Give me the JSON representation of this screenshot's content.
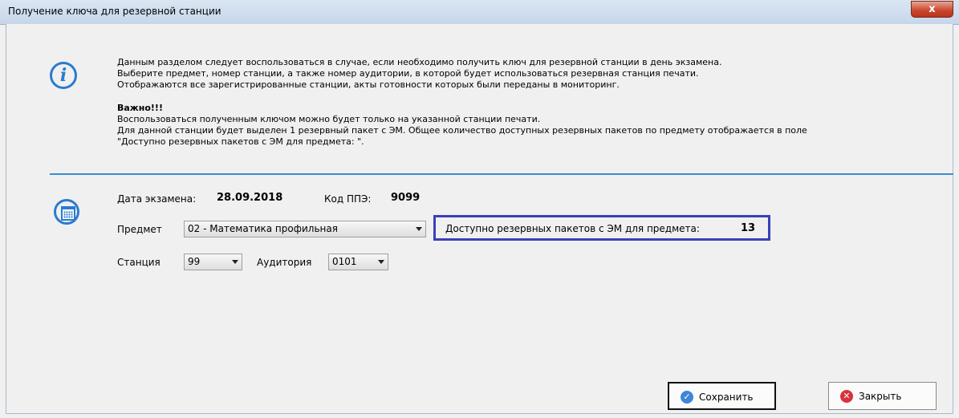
{
  "window": {
    "title": "Получение ключа для резервной станции",
    "close_glyph": "x"
  },
  "info": {
    "icon": "info-icon",
    "lines": [
      "Данным разделом следует воспользоваться в случае, если необходимо получить ключ для резервной станции в день экзамена.",
      "Выберите предмет, номер станции, а также номер аудитории, в которой будет использоваться резервная станция печати.",
      "Отображаются все зарегистрированные станции, акты готовности которых были переданы в мониторинг."
    ],
    "important_title": "Важно!!!",
    "important_lines": [
      "Воспользоваться полученным ключом можно будет только на указанной станции печати.",
      "Для данной станции будет выделен 1 резервный пакет с ЭМ. Общее количество доступных резервных пакетов по предмету отображается в поле",
      "\"Доступно резервных пакетов с ЭМ для предмета: \"."
    ]
  },
  "form": {
    "icon": "calendar-icon",
    "exam_date_label": "Дата экзамена:",
    "exam_date_value": "28.09.2018",
    "ppe_code_label": "Код ППЭ:",
    "ppe_code_value": "9099",
    "subject_label": "Предмет",
    "subject_value": "02 - Математика профильная",
    "available_label": "Доступно резервных пакетов с ЭМ для предмета:",
    "available_value": "13",
    "station_label": "Станция",
    "station_value": "99",
    "auditorium_label": "Аудитория",
    "auditorium_value": "0101"
  },
  "buttons": {
    "save_label": "Сохранить",
    "close_label": "Закрыть"
  },
  "colors": {
    "accent": "#3b8bd3",
    "highlight_border": "#3a40b8",
    "close_red": "#d8323c"
  }
}
